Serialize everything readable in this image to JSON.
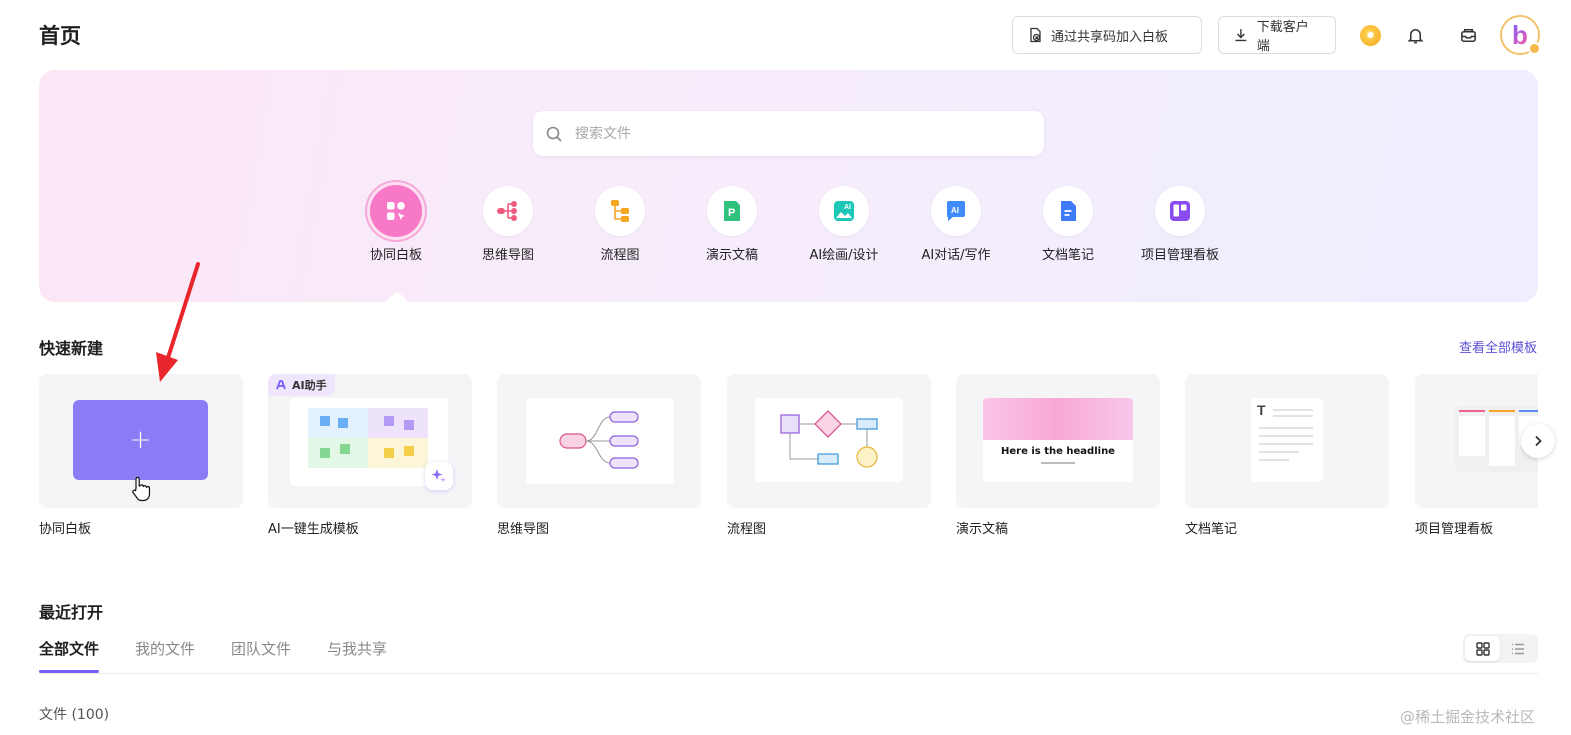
{
  "header": {
    "title": "首页",
    "join_board_label": "通过共享码加入白板",
    "download_label": "下载客户端",
    "avatar_letter": "b"
  },
  "hero": {
    "search_placeholder": "搜索文件",
    "categories": [
      {
        "label": "协同白板",
        "icon": "whiteboard-icon",
        "active": true
      },
      {
        "label": "思维导图",
        "icon": "mindmap-icon"
      },
      {
        "label": "流程图",
        "icon": "flowchart-icon"
      },
      {
        "label": "演示文稿",
        "icon": "presentation-icon"
      },
      {
        "label": "AI绘画/设计",
        "icon": "ai-painting-icon"
      },
      {
        "label": "AI对话/写作",
        "icon": "ai-chat-icon"
      },
      {
        "label": "文档笔记",
        "icon": "document-icon"
      },
      {
        "label": "项目管理看板",
        "icon": "kanban-icon"
      }
    ]
  },
  "quick_create": {
    "title": "快速新建",
    "view_all_label": "查看全部模板",
    "templates": [
      {
        "label": "协同白板",
        "new_symbol": "+"
      },
      {
        "label": "AI一键生成模板",
        "badge": "AI助手"
      },
      {
        "label": "思维导图"
      },
      {
        "label": "流程图"
      },
      {
        "label": "演示文稿",
        "thumb_headline": "Here is the headline"
      },
      {
        "label": "文档笔记",
        "thumb_letter": "T"
      },
      {
        "label": "项目管理看板"
      }
    ]
  },
  "recent": {
    "title": "最近打开",
    "tabs": [
      "全部文件",
      "我的文件",
      "团队文件",
      "与我共享"
    ],
    "active_tab": "全部文件",
    "file_count": "文件 (100)",
    "view_mode": "grid"
  },
  "watermark": "@稀土掘金技术社区",
  "colors": {
    "accent": "#7b5cf6",
    "new_board": "#8b7cf6",
    "active_category": "#f878c8",
    "link": "#5b52d6"
  }
}
